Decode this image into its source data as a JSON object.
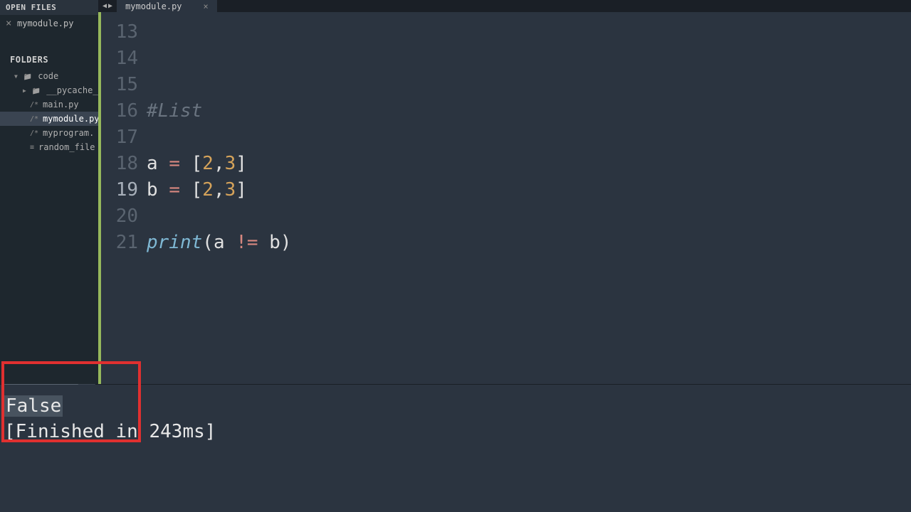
{
  "sidebar": {
    "open_files_label": "OPEN FILES",
    "open_files": [
      "mymodule.py"
    ],
    "folders_label": "FOLDERS",
    "root_folder": "code",
    "items": [
      {
        "type": "folder",
        "label": "__pycache__"
      },
      {
        "type": "file",
        "label": "main.py"
      },
      {
        "type": "file",
        "label": "mymodule.py",
        "active": true
      },
      {
        "type": "file",
        "label": "myprogram."
      },
      {
        "type": "file",
        "label": "random_file"
      }
    ]
  },
  "tabs": {
    "nav_prev": "◀",
    "nav_next": "▶",
    "active": "mymodule.py",
    "close": "×"
  },
  "editor": {
    "lines": [
      {
        "n": 13,
        "tokens": []
      },
      {
        "n": 14,
        "tokens": []
      },
      {
        "n": 15,
        "tokens": []
      },
      {
        "n": 16,
        "tokens": [
          {
            "t": "#List",
            "c": "cm"
          }
        ]
      },
      {
        "n": 17,
        "tokens": []
      },
      {
        "n": 18,
        "tokens": [
          {
            "t": "a ",
            "c": "var"
          },
          {
            "t": "=",
            "c": "op"
          },
          {
            "t": " ",
            "c": "var"
          },
          {
            "t": "[",
            "c": "punc"
          },
          {
            "t": "2",
            "c": "num"
          },
          {
            "t": ",",
            "c": "punc"
          },
          {
            "t": "3",
            "c": "num"
          },
          {
            "t": "]",
            "c": "punc"
          }
        ]
      },
      {
        "n": 19,
        "highlight": true,
        "tokens": [
          {
            "t": "b ",
            "c": "var"
          },
          {
            "t": "=",
            "c": "op"
          },
          {
            "t": " ",
            "c": "var"
          },
          {
            "t": "[",
            "c": "punc"
          },
          {
            "t": "2",
            "c": "num"
          },
          {
            "t": ",",
            "c": "punc"
          },
          {
            "t": "3",
            "c": "num"
          },
          {
            "t": "]",
            "c": "punc"
          }
        ]
      },
      {
        "n": 20,
        "tokens": []
      },
      {
        "n": 21,
        "tokens": [
          {
            "t": "print",
            "c": "fn"
          },
          {
            "t": "(",
            "c": "punc"
          },
          {
            "t": "a ",
            "c": "var"
          },
          {
            "t": "!=",
            "c": "op"
          },
          {
            "t": " b",
            "c": "var"
          },
          {
            "t": ")",
            "c": "punc"
          }
        ]
      }
    ]
  },
  "output": {
    "result": "False",
    "finished": "[Finished in 243ms]"
  }
}
